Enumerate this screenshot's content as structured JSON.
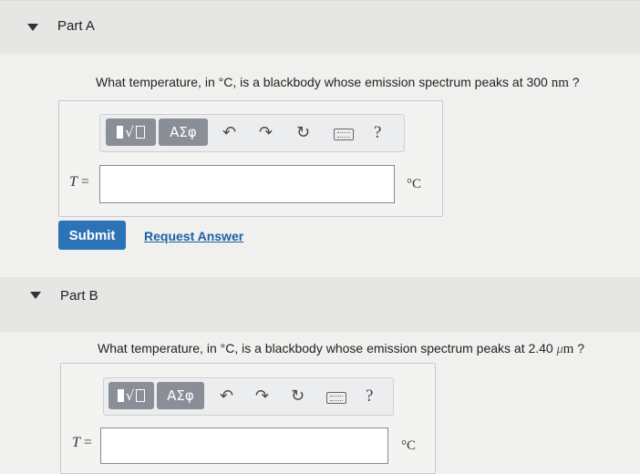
{
  "partA": {
    "title": "Part A",
    "question_prefix": "What temperature, in °C, is a blackbody whose emission spectrum peaks at 300",
    "question_unit": "nm",
    "question_suffix": "?",
    "variable": "T",
    "equals": "=",
    "unit": "°C",
    "submit_label": "Submit",
    "request_label": "Request Answer",
    "input_value": ""
  },
  "partB": {
    "title": "Part B",
    "question_prefix": "What temperature, in °C, is a blackbody whose emission spectrum peaks at 2.40",
    "question_unit_mu": "μ",
    "question_unit": "m",
    "question_suffix": "?",
    "variable": "T",
    "equals": "=",
    "unit": "°C",
    "input_value": ""
  },
  "toolbar": {
    "templates_icon": "sqrt-template-icon",
    "greek_label": "ΑΣφ",
    "undo_icon": "undo-icon",
    "redo_icon": "redo-icon",
    "reset_icon": "reset-icon",
    "keyboard_icon": "keyboard-icon",
    "help_label": "?"
  }
}
